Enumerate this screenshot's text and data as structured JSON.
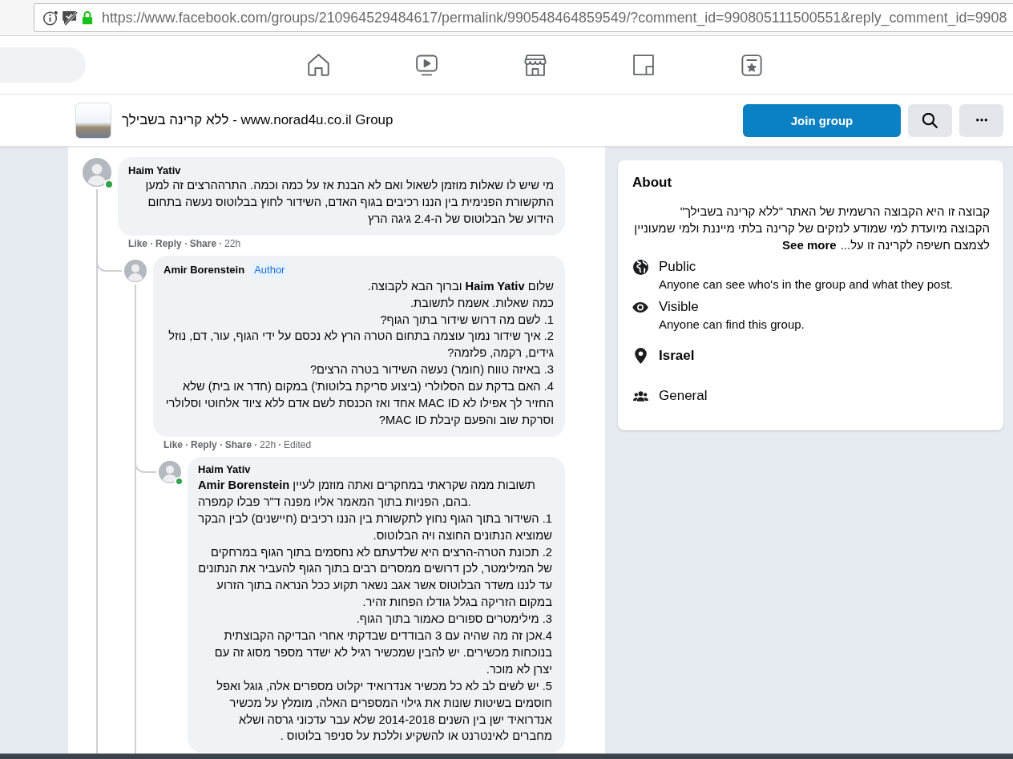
{
  "browser": {
    "url": "https://www.facebook.com/groups/210964529484617/permalink/990548464859549/?comment_id=990805111500551&reply_comment_id=9908"
  },
  "nav": {
    "tabs": [
      {
        "kind": "home",
        "selected": false
      },
      {
        "kind": "watch",
        "selected": false
      },
      {
        "kind": "marketplace",
        "selected": false
      },
      {
        "kind": "groups",
        "selected": false
      },
      {
        "kind": "gaming",
        "selected": false
      }
    ]
  },
  "group": {
    "name": "ללא קרינה בשבילך - www.norad4u.co.il Group",
    "join_button": "Join group"
  },
  "comments": [
    {
      "author": "Haim Yativ",
      "online": true,
      "paragraphs": [
        "מי שיש לו שאלות מוזמן לשאול ואם לא הבנת אז על כמה וכמה. התרההרצים זה למען התקשורת הפנימית בין הננו רכיבים בגוף האדם, השידור לחוץ בבלוטוס נעשה בתחום הידוע של הבלוטוס של ה-2.4 גיגה הרץ"
      ],
      "like": "Like",
      "reply": "Reply",
      "share": "Share",
      "time": "22h",
      "replies": [
        {
          "author": "Amir Borenstein",
          "online": false,
          "badge": "Author",
          "paragraphs": [
            "שלום **Haim Yativ** וברוך הבא לקבוצה.",
            "כמה שאלות. אשמח לתשובת.",
            "1. לשם מה דרוש שידור בתוך הגוף?",
            "2. איך שידור נמוך עוצמה בתחום הטרה הרץ לא נכסם על ידי הגוף, עור, דם, נוזל גידים, רקמה, פלזמה?",
            "3. באיזה טווח (חומר) נעשה השידור בטרה הרצים?",
            "4. האם בדקת עם הסלולרי (ביצוע סריקת בלוטות') במקום (חדר או בית) שלא החזיר לך אפילו לא MAC ID אחד ואז הכנסת לשם אדם ללא ציוד אלחוטי וסלולרי וסרקת שוב והפעם קיבלת MAC ID?"
          ],
          "like": "Like",
          "reply": "Reply",
          "share": "Share",
          "time": "22h",
          "edited": "Edited",
          "replies": [
            {
              "author": "Haim Yativ",
              "online": true,
              "paragraphs": [
                "**Amir Borenstein** תשובות ממה שקראתי במחקרים ואתה מוזמן לעיין בהם, הפניות בתוך המאמר אליו מפנה ד\"ר פבלו קמפרה.",
                "1. השידור בתוך הגוף נחוץ לתקשורת בין הננו רכיבים (חיישנים) לבין הבקר שמוציא הנתונים החוצה ויה הבלוטוס.",
                "2. תכונת הטרה-הרצים היא שלדעתם לא נחסמים בתוך הגוף במרחקים של המילימטר, לכן דרושים ממסרים רבים בתוך הגוף להעביר את הנתונים עד לננו משדר הבלוטוס אשר אגב נשאר תקוע ככל הנראה בתוך הזרוע במקום הזריקה בגלל גודלו הפחות זהיר.",
                "3. מילימטרים ספורים כאמור בתוך הגוף.",
                "4.אכן זה מה שהיה עם 3 הבודדים שבדקתי אחרי הבדיקה הקבוצתית בנוכחות מכשירים. יש להבין שמכשיר רגיל לא ישדר מספר מסוג זה עם יצרן לא מוכר.",
                "5. יש לשים לב לא כל מכשיר אנדרואיד יקלוט מספרים אלה, גוגל ואפל חוסמים בשיטות שונות את גילוי המספרים האלה, מומלץ על מכשיר אנדרואיד ישן בין השנים 2014-2018 שלא עבר עדכוני גרסה ושלא מחברים לאינטרנט או להשקיע וללכת על סניפר בלוטוס ."
              ]
            }
          ]
        }
      ]
    }
  ],
  "about": {
    "title": "About",
    "description": [
      "קבוצה זו היא הקבוצה הרשמית של האתר \"ללא קרינה בשבילך\"",
      "הקבוצה מיועדת למי שמודע לנזקים של קרינה בלתי מייננת ולמי שמעוניין לצמצם חשיפה לקרינה זו על..."
    ],
    "see_more": "See more",
    "items": [
      {
        "kind": "privacy",
        "title": "Public",
        "description": "Anyone can see who's in the group and what they post."
      },
      {
        "kind": "visibility",
        "title": "Visible",
        "description": "Anyone can find this group."
      },
      {
        "kind": "location",
        "title": "Israel"
      },
      {
        "kind": "category",
        "title": "General"
      }
    ]
  }
}
